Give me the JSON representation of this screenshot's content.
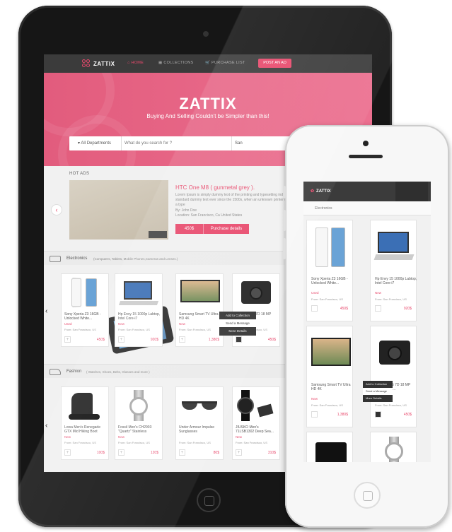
{
  "brand": {
    "name": "ZATTIX",
    "accent": "#e8496c"
  },
  "nav": {
    "home": "HOME",
    "collections": "COLLECTIONS",
    "purchase": "PURCHASE LIST",
    "post_ad": "POST AN AD"
  },
  "hero": {
    "title": "ZATTIX",
    "subtitle": "Buying And Selling Couldn't be Simpler than this!"
  },
  "search": {
    "department": "All Departments",
    "placeholder": "What do you search for ?",
    "location": "San"
  },
  "hot_ads": {
    "label": "HOT ADS",
    "title": "HTC One M8 ( gunmetal grey ).",
    "description": "Lorem Ipsum is simply dummy text of the printing and typesetting industry. Lorem Ipsum has been the industry's standard dummy text ever since the 1500s, when an unknown printer took a galley of type and scrambled it to make a type",
    "by": "By: John Doe",
    "location": "Location: San Francisco, Ca United States",
    "price": "450$",
    "details": "Purchase details"
  },
  "electronics": {
    "name": "Electronics",
    "sub": "(Computers, Tablets, Mobile Phones,Cameras and Lenses.)",
    "items": [
      {
        "name": "Sony Xperia Z3 16GB - Unlocked White...",
        "status": "Used",
        "from": "From: San Francisco, US",
        "price": "450$"
      },
      {
        "name": "Hp Envy 15 1000p Labtop, Intel Core-i7",
        "status": "New",
        "from": "From: San Francisco, US",
        "price": "920$"
      },
      {
        "name": "Samsung Smart TV Ultra HD 4K",
        "status": "New",
        "from": "From: San Francisco, US",
        "price": "1,380$"
      },
      {
        "name": "Canon EOS 7D 18 MP Digital SLR...",
        "status": "Used",
        "from": "From: San Francisco, US",
        "price": "450$"
      }
    ]
  },
  "context_menu": {
    "items": [
      "Add to Collection",
      "Send a Message",
      "More Details"
    ]
  },
  "fashion": {
    "name": "Fashion",
    "sub": "( Watches, Shoes, Belts, Glasses and more )",
    "items": [
      {
        "name": "Lowa Men's Renegade GTX Mid Hiking Boot",
        "status": "New",
        "from": "From: San Francisco, US",
        "price": "100$"
      },
      {
        "name": "Fossil Men's CH2903 \"Quartz\" Stainless",
        "status": "New",
        "from": "From: San Francisco, US",
        "price": "120$"
      },
      {
        "name": "Under Armour Impulse Sunglasses",
        "status": "",
        "from": "From: San Francisco, US",
        "price": "80$"
      },
      {
        "name": "JIUSKO Men's 71LSB1302 Deep Sea...",
        "status": "New",
        "from": "From: San Francisco, US",
        "price": "310$"
      }
    ]
  },
  "phone": {
    "breadcrumb": "Electronics",
    "items": [
      {
        "name": "Sony Xperia Z3 16GB - Unlocked White...",
        "status": "Used",
        "from": "From: San Francisco, US",
        "price": "450$"
      },
      {
        "name": "Hp Envy 15 1000p Labtop, Intel Core-i7",
        "status": "New",
        "from": "From: San Francisco, US",
        "price": "920$"
      },
      {
        "name": "Samsung Smart TV Ultra HD 4K",
        "status": "New",
        "from": "From: San Francisco, US",
        "price": "1,380$"
      },
      {
        "name": "Canon EOS 7D 18 MP Digital SLR...",
        "status": "Used",
        "from": "From: San Francisco, US",
        "price": "450$"
      }
    ],
    "context_menu": [
      "Add to Collection",
      "Send a Message",
      "More Details"
    ]
  }
}
